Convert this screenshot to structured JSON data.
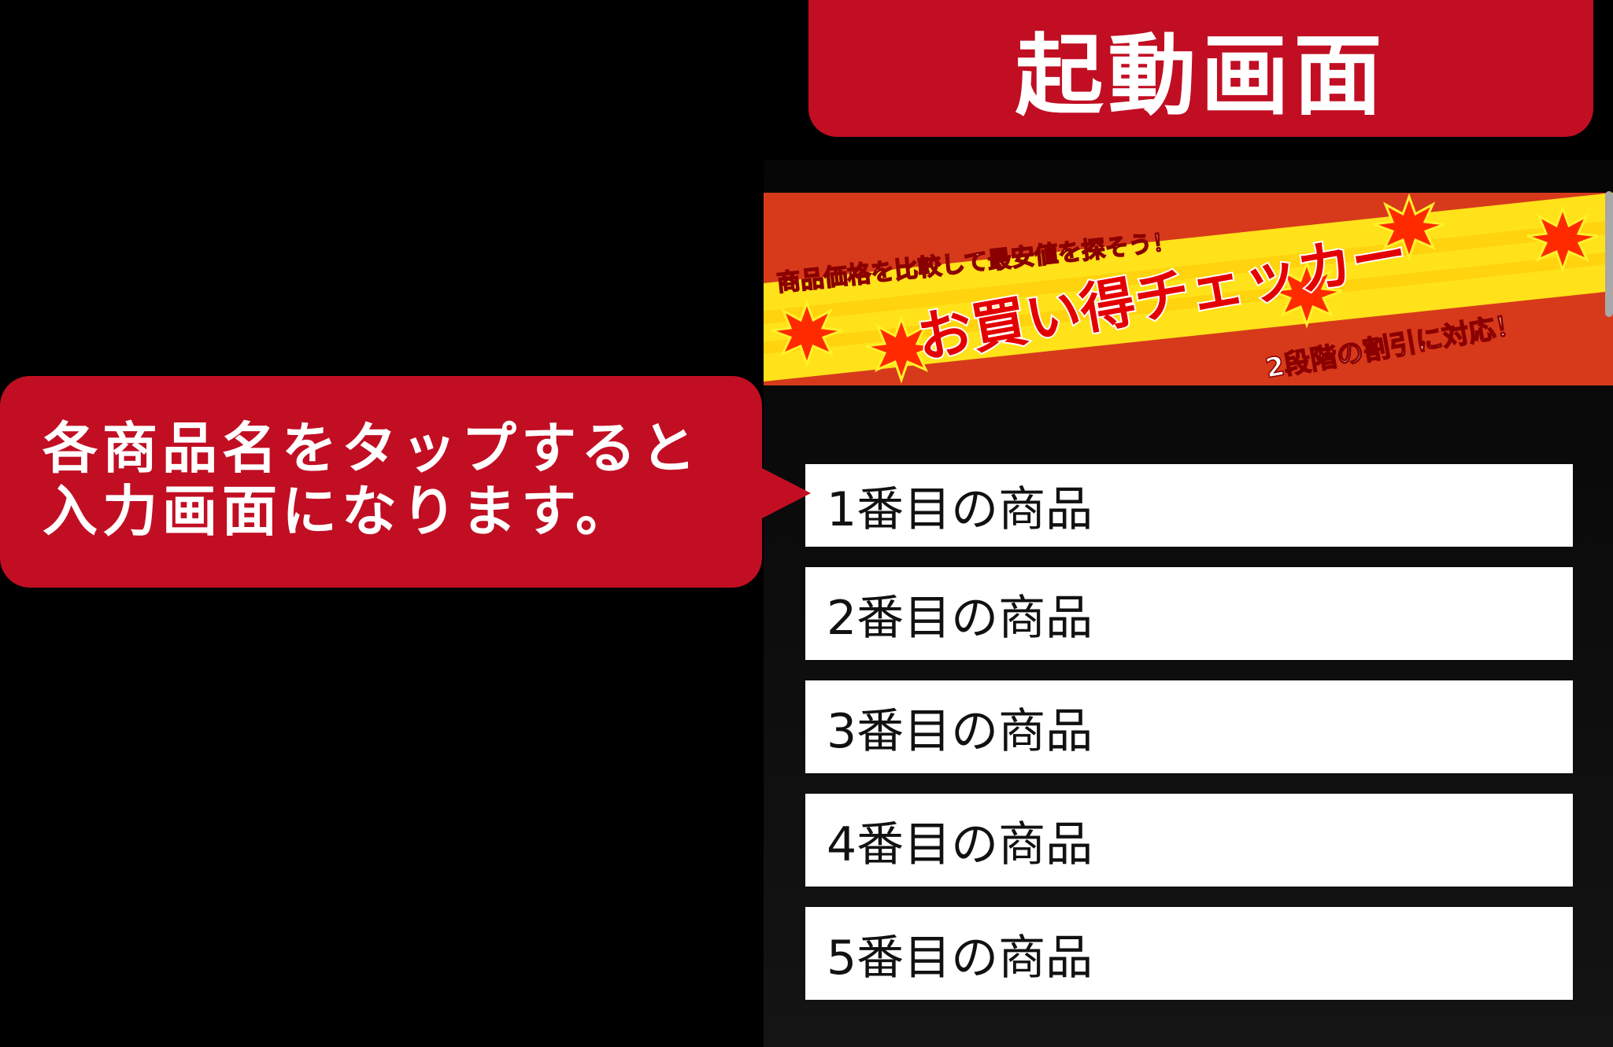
{
  "title_banner": {
    "text": "起動画面"
  },
  "callout": {
    "line1": "各商品名をタップすると",
    "line2": "入力画面になります。"
  },
  "app": {
    "banner": {
      "tagline": "商品価格を比較して最安値を探そう！",
      "logo": "お買い得チェッカー",
      "feature": "2段階の割引に対応！"
    },
    "items": [
      {
        "label": "1番目の商品"
      },
      {
        "label": "2番目の商品"
      },
      {
        "label": "3番目の商品"
      },
      {
        "label": "4番目の商品"
      },
      {
        "label": "5番目の商品"
      }
    ]
  },
  "colors": {
    "accent_red": "#c10e23",
    "banner_orange": "#d73a1b",
    "banner_yellow": "#ffe21a",
    "background": "#000000"
  }
}
